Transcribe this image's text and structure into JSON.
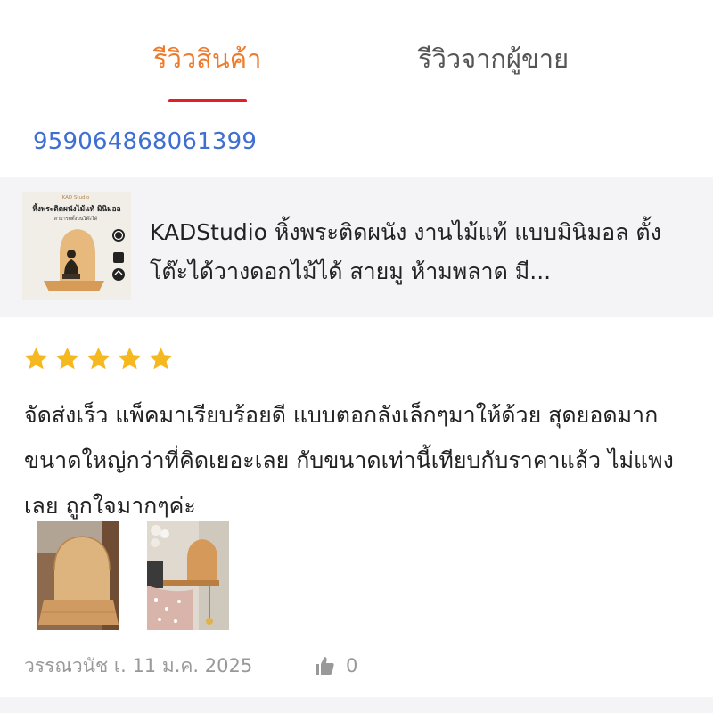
{
  "tabs": [
    {
      "label": "รีวิวสินค้า",
      "active": true
    },
    {
      "label": "รีวิวจากผู้ขาย",
      "active": false
    }
  ],
  "order_id": "959064868061399",
  "product": {
    "thumbnail": {
      "brand": "KAD Studio",
      "headline": "หิ้งพระติดผนังไม้แท้ มินิมอล",
      "subline": "สามารถตั้งบนโต๊ะได้"
    },
    "title": "KADStudio หิ้งพระติดผนัง งานไม้แท้ แบบมินิมอล ตั้งโต๊ะได้วางดอกไม้ได้ สายมู ห้ามพลาด มี..."
  },
  "review": {
    "rating": 5,
    "rating_max": 5,
    "text": "จัดส่งเร็ว แพ็คมาเรียบร้อยดี แบบตอกลังเล็กๆมาให้ด้วย สุดยอดมาก ขนาดใหญ่กว่าที่คิดเยอะเลย กับขนาดเท่านี้เทียบกับราคาแล้ว ไม่แพงเลย ถูกใจมากๆค่ะ",
    "photos": [
      "review-photo-shelf-wood",
      "review-photo-shelf-on-wall"
    ],
    "author": "วรรณวนัช",
    "date": "เ. 11 ม.ค. 2025",
    "like_count": "0"
  },
  "colors": {
    "active_tab": "#ee7a2c",
    "active_underline": "#e31e24",
    "order_link": "#3f6fd0",
    "star": "#f5b820",
    "muted": "#999999"
  },
  "icons": {
    "star": "star-icon",
    "like": "thumbs-up-icon"
  }
}
